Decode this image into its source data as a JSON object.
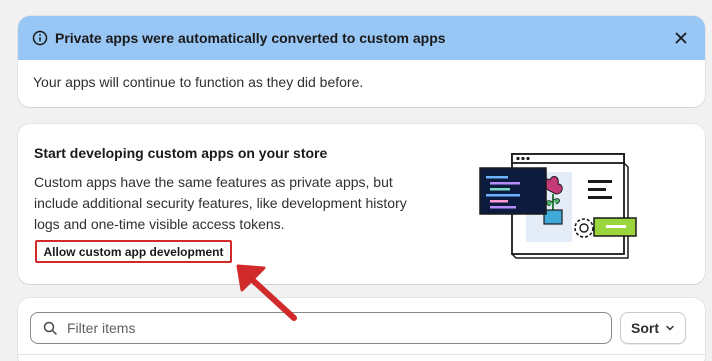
{
  "banner": {
    "title": "Private apps were automatically converted to custom apps",
    "body": "Your apps will continue to function as they did before.",
    "icon": "info-icon",
    "close_icon": "close-icon",
    "background": "#98c6f5"
  },
  "dev_card": {
    "title": "Start developing custom apps on your store",
    "description": "Custom apps have the same features as private apps, but include additional security features, like development history logs and one-time visible access tokens.",
    "button_label": "Allow custom app development",
    "highlight_color": "#d12a2a"
  },
  "filter": {
    "search_placeholder": "Filter items",
    "search_icon": "search-icon",
    "sort_label": "Sort",
    "sort_icon": "chevron-down-icon"
  },
  "annotation": {
    "arrow_color": "#d12a2a"
  }
}
